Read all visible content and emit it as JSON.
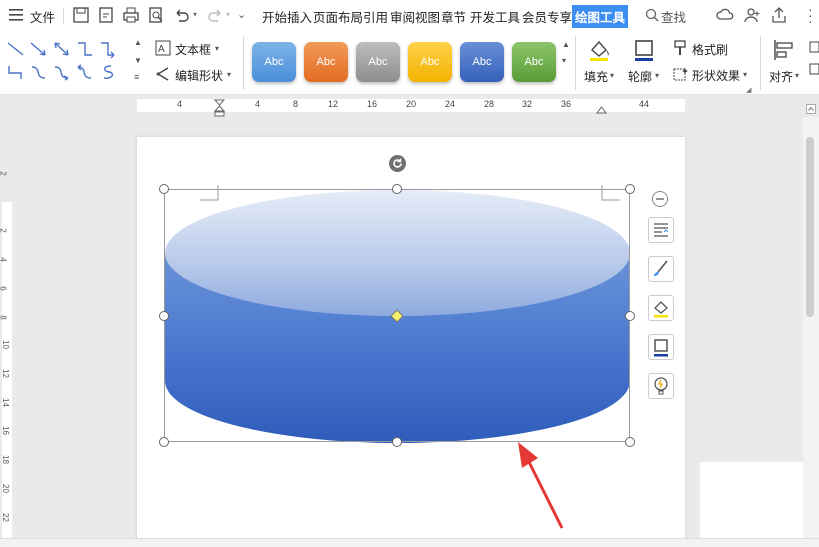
{
  "menubar": {
    "file_label": "文件",
    "tabs": [
      "开始",
      "插入",
      "页面布局",
      "引用",
      "审阅",
      "视图",
      "章节",
      "开发工具",
      "会员专享",
      "绘图工具"
    ],
    "search_label": "查找"
  },
  "ribbon": {
    "textbox_label": "文本框",
    "edit_shape_label": "编辑形状",
    "style_presets": [
      {
        "label": "Abc",
        "color": "#5b9bd5"
      },
      {
        "label": "Abc",
        "color": "#ed7d31"
      },
      {
        "label": "Abc",
        "color": "#a5a5a5"
      },
      {
        "label": "Abc",
        "color": "#ffc000"
      },
      {
        "label": "Abc",
        "color": "#4472c4"
      },
      {
        "label": "Abc",
        "color": "#70ad47"
      }
    ],
    "fill_label": "填充",
    "outline_label": "轮廓",
    "format_brush_label": "格式刷",
    "shape_effect_label": "形状效果",
    "align_label": "对齐"
  },
  "ruler": {
    "numbers": [
      "4",
      "4",
      "8",
      "12",
      "16",
      "20",
      "24",
      "28",
      "32",
      "36",
      "44"
    ]
  },
  "vruler": {
    "numbers": [
      "2",
      "2",
      "4",
      "6",
      "8",
      "10",
      "12",
      "14",
      "16",
      "18",
      "20",
      "22"
    ]
  },
  "colors": {
    "accent": "#3c8ef3",
    "cylinder_top": "#4472c4",
    "arrow": "#e53935"
  }
}
